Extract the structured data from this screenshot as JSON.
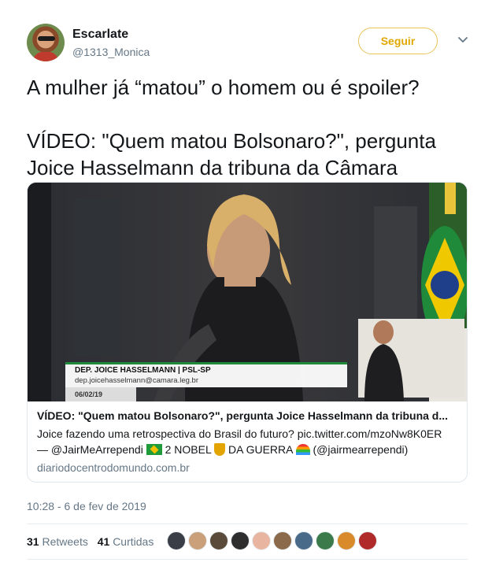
{
  "user": {
    "name": "Escarlate",
    "handle": "@1313_Monica",
    "follow_label": "Seguir"
  },
  "tweet": {
    "text": "A mulher já “matou” o homem ou é spoiler?\n\nVÍDEO: \"Quem matou Bolsonaro?\", pergunta Joice Hasselmann da tribuna da Câmara",
    "timestamp": "10:28 - 6 de fev de 2019"
  },
  "card": {
    "lower_third_name": "DEP. JOICE HASSELMANN | PSL-SP",
    "lower_third_email": "dep.joicehasselmann@camara.leg.br",
    "video_date": "06/02/19",
    "title": "VÍDEO: \"Quem matou Bolsonaro?\", pergunta Joice Hasselmann da tribuna d...",
    "desc_line1": "Joice fazendo uma retrospectiva do Brasil do futuro? pic.twitter.com/mzoNw8K0ER",
    "desc_line2_a": "— @JairMeArrependi",
    "desc_line2_b": "2 NOBEL",
    "desc_line2_c": "DA GUERRA",
    "desc_line2_d": "(@jairmearrependi)",
    "domain": "diariodocentrodomundo.com.br"
  },
  "stats": {
    "retweets_count": "31",
    "retweets_label": "Retweets",
    "likes_count": "41",
    "likes_label": "Curtidas"
  },
  "likers": [
    {
      "color": "#3a3f47"
    },
    {
      "color": "#c9a07a"
    },
    {
      "color": "#5a4a3a"
    },
    {
      "color": "#2e2e2e"
    },
    {
      "color": "#e8b6a0"
    },
    {
      "color": "#8a6a4a"
    },
    {
      "color": "#4a6a8a"
    },
    {
      "color": "#3b7a4a"
    },
    {
      "color": "#d98a2a"
    },
    {
      "color": "#b02a2a"
    }
  ],
  "colors": {
    "follow_border": "#e8c35a",
    "follow_text": "#e0a800",
    "muted_text": "#657786",
    "primary_text": "#14171a"
  },
  "icons": {
    "more": "chevron-down-icon",
    "flag": "brazil-flag-icon",
    "trophy": "trophy-icon",
    "rainbow": "rainbow-icon"
  }
}
